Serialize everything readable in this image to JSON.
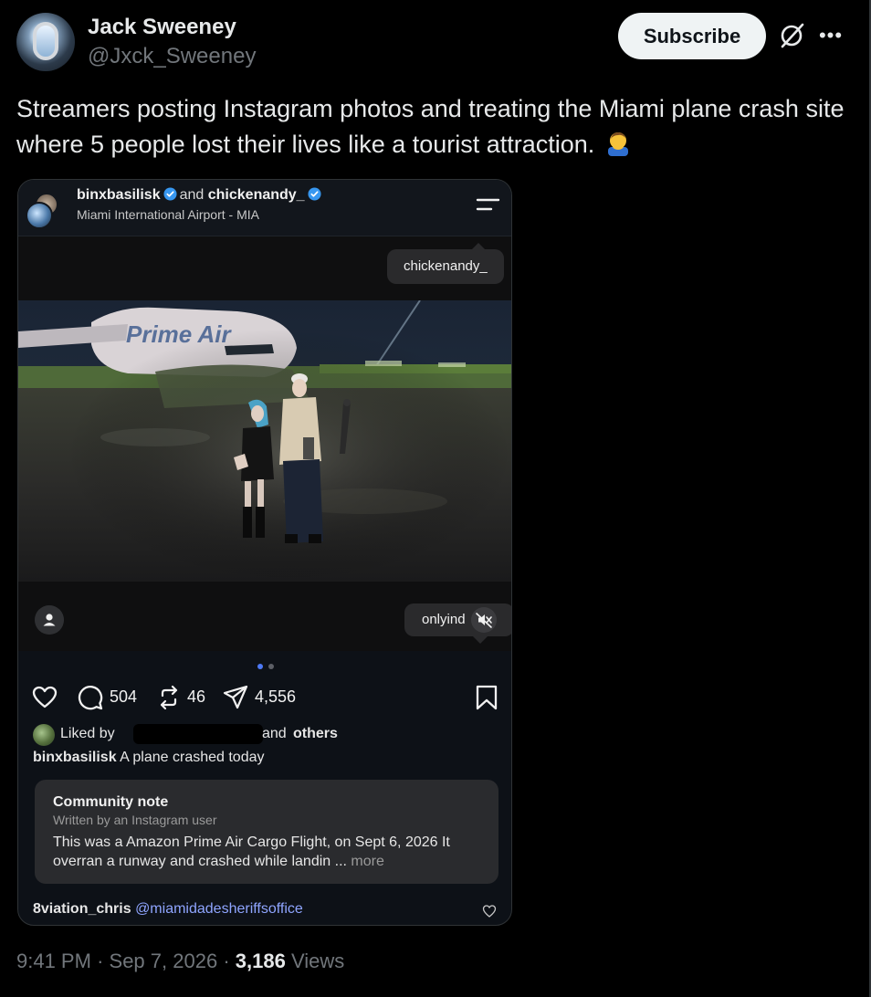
{
  "author": {
    "name": "Jack Sweeney",
    "handle": "@Jxck_Sweeney"
  },
  "subscribe_label": "Subscribe",
  "tweet": {
    "text": "Streamers posting Instagram photos and treating the Miami plane crash site where 5 people lost their lives like a tourist attraction."
  },
  "embed": {
    "user1": "binxbasilisk",
    "and_text": "and",
    "user2": "chickenandy_",
    "location": "Miami International Airport - MIA",
    "tag_top": "chickenandy_",
    "tag_bottom": "onlyind",
    "carousel": {
      "count": 2,
      "active_index": 0
    },
    "comments_count": "504",
    "reposts_count": "46",
    "shares_count": "4,556",
    "liked_by_label": "Liked by",
    "liked_and": "and",
    "liked_others": "others",
    "caption_user": "binxbasilisk",
    "caption_text": "A plane crashed today",
    "community_note": {
      "title": "Community note",
      "subtitle": "Written by an Instagram user",
      "body": "This was a Amazon Prime Air Cargo Flight, on Sept 6, 2026 It overran a runway and crashed while landin ...",
      "more_label": "more"
    },
    "comment_user": "8viation_chris",
    "comment_mention": "@miamidadesheriffsoffice"
  },
  "meta": {
    "time": "9:41 PM",
    "separator": "·",
    "date": "Sep 7, 2026",
    "views_count": "3,186",
    "views_label": "Views"
  },
  "icons": [
    "grok-icon",
    "more-icon",
    "verified-icon",
    "menu-icon",
    "user-icon",
    "mute-icon",
    "heart-icon",
    "comment-icon",
    "repost-icon",
    "share-icon",
    "bookmark-icon",
    "face-emoji"
  ],
  "colors": {
    "background": "#000000",
    "text_primary": "#e7e9ea",
    "text_secondary": "#71767b",
    "subscribe_bg": "#eff3f4",
    "verified_blue": "#3797f0",
    "mention_blue": "#8fa5ff"
  }
}
